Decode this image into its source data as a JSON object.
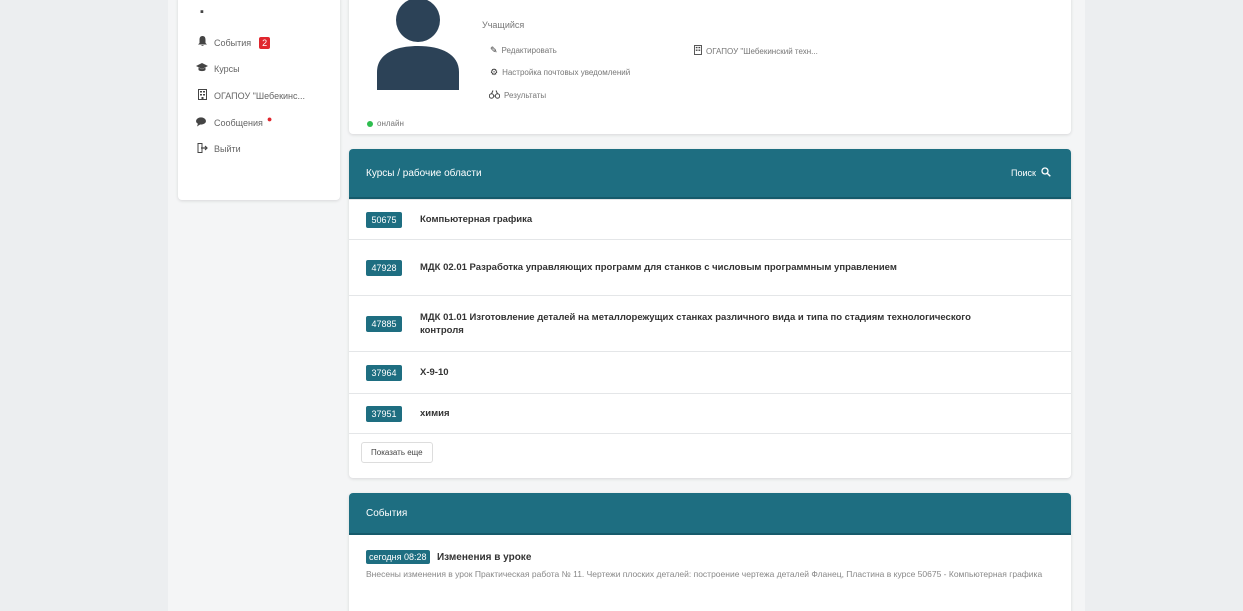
{
  "colors": {
    "accent": "#1e6e81",
    "badge_red": "#e0262e",
    "online_green": "#2ebd4f"
  },
  "sidebar": {
    "items": [
      {
        "icon": "bell-icon",
        "label": "События",
        "badge": "2"
      },
      {
        "icon": "graduation-cap-icon",
        "label": "Курсы"
      },
      {
        "icon": "building-icon",
        "label": "ОГАПОУ \"Шебекинс..."
      },
      {
        "icon": "chat-icon",
        "label": "Сообщения"
      },
      {
        "icon": "sign-out-icon",
        "label": "Выйти"
      }
    ]
  },
  "profile": {
    "role": "Учащийся",
    "status": "онлайн",
    "links": {
      "edit": "Редактировать",
      "mail_settings": "Настройка почтовых уведомлений",
      "results": "Результаты",
      "org": "ОГАПОУ \"Шебекинский техн..."
    }
  },
  "courses": {
    "title": "Курсы / рабочие области",
    "search_label": "Поиск",
    "items": [
      {
        "id": "50675",
        "title": "Компьютерная графика"
      },
      {
        "id": "47928",
        "title": "МДК 02.01 Разработка управляющих программ для станков с числовым программным управлением"
      },
      {
        "id": "47885",
        "title": "МДК 01.01 Изготовление деталей на металлорежущих станках различного вида и типа по стадиям технологического контроля"
      },
      {
        "id": "37964",
        "title": "Х-9-10"
      },
      {
        "id": "37951",
        "title": "химия"
      }
    ],
    "more_button": "Показать еще"
  },
  "events": {
    "title": "События",
    "items": [
      {
        "date": "сегодня 08:28",
        "title": "Изменения в уроке",
        "description": "Внесены изменения в урок Практическая работа № 11. Чертежи плоских деталей: построение чертежа деталей Фланец, Пластина в курсе 50675 - Компьютерная графика"
      }
    ]
  }
}
